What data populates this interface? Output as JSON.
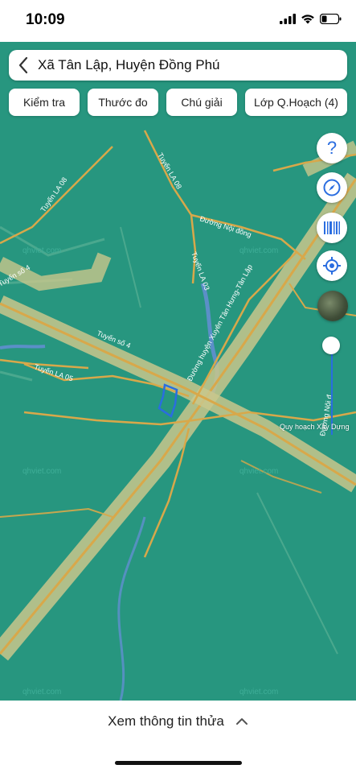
{
  "status_bar": {
    "time": "10:09"
  },
  "header": {
    "title": "Xã Tân Lập, Huyện Đồng Phú"
  },
  "tools": [
    {
      "label": "Kiểm tra"
    },
    {
      "label": "Thước đo"
    },
    {
      "label": "Chú giải"
    },
    {
      "label": "Lớp Q.Hoạch (4)"
    }
  ],
  "side_buttons": {
    "help_glyph": "?"
  },
  "map": {
    "road_labels": [
      "Tuyến LA 08",
      "Tuyến LA 08",
      "Đường Nội đồng",
      "Tuyến LA 03",
      "Đường huyện Xuyên Tân Hưng-Tân Lập",
      "Tuyến số 4",
      "Tuyến số 4",
      "Tuyến LA 05",
      "Đường Nội đ"
    ],
    "watermarks": [
      "qhviet.com",
      "qhviet.com",
      "qhviet.com",
      "qhviet.com",
      "qhviet.com",
      "qhviet.com"
    ],
    "slider_label": "Quy hoạch Xây Dựng",
    "colors": {
      "land": "#27967f",
      "road": "#d8a84a",
      "highway": "#c9c78c",
      "water": "#5b8fc8",
      "parcel_outline": "#2a6de0"
    }
  },
  "bottom": {
    "label": "Xem thông tin thửa"
  }
}
